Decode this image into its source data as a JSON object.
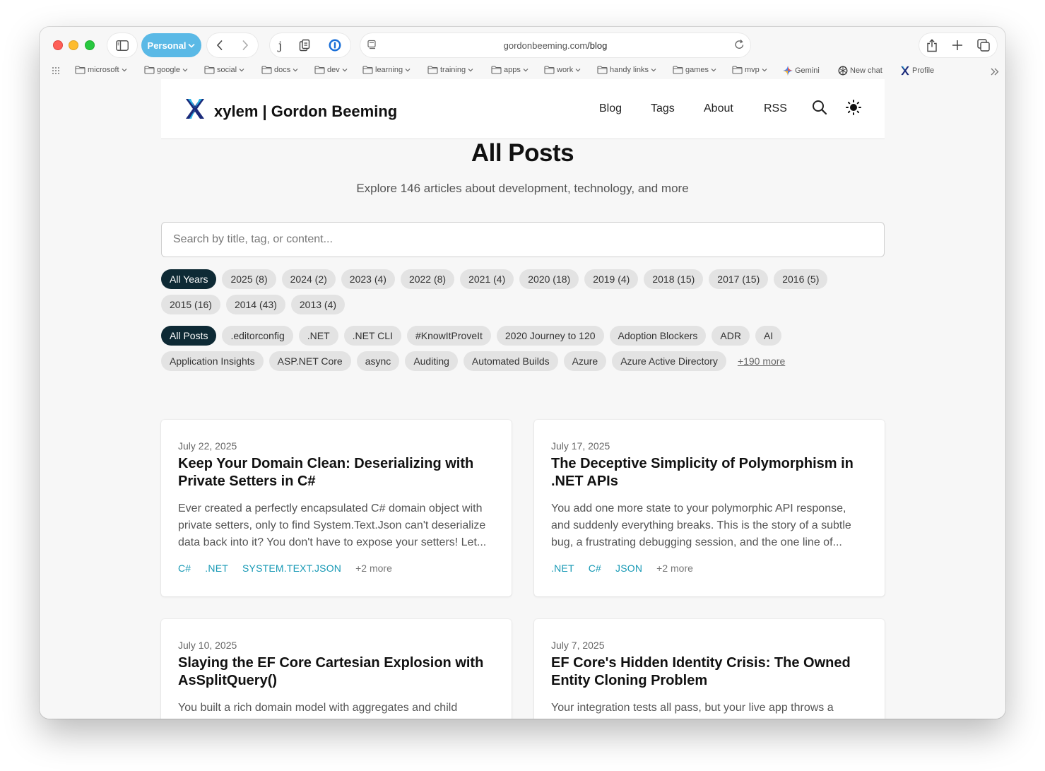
{
  "browser": {
    "profile_label": "Personal",
    "url_domain": "gordonbeeming.com",
    "url_path": "/blog",
    "extension_letter": "j",
    "bookmarks": [
      {
        "label": "microsoft",
        "icon": "folder-icon",
        "dropdown": true
      },
      {
        "label": "google",
        "icon": "folder-icon",
        "dropdown": true
      },
      {
        "label": "social",
        "icon": "folder-icon",
        "dropdown": true
      },
      {
        "label": "docs",
        "icon": "folder-icon",
        "dropdown": true
      },
      {
        "label": "dev",
        "icon": "folder-icon",
        "dropdown": true
      },
      {
        "label": "learning",
        "icon": "folder-icon",
        "dropdown": true
      },
      {
        "label": "training",
        "icon": "folder-icon",
        "dropdown": true
      },
      {
        "label": "apps",
        "icon": "folder-icon",
        "dropdown": true
      },
      {
        "label": "work",
        "icon": "folder-icon",
        "dropdown": true
      },
      {
        "label": "handy links",
        "icon": "folder-icon",
        "dropdown": true
      },
      {
        "label": "games",
        "icon": "folder-icon",
        "dropdown": true
      },
      {
        "label": "mvp",
        "icon": "folder-icon",
        "dropdown": true
      },
      {
        "label": "Gemini",
        "icon": "gemini-icon",
        "dropdown": false
      },
      {
        "label": "New chat",
        "icon": "openai-icon",
        "dropdown": false
      },
      {
        "label": "Profile",
        "icon": "xylem-icon",
        "dropdown": false
      }
    ]
  },
  "site": {
    "title": "xylem | Gordon Beeming",
    "nav": [
      "Blog",
      "Tags",
      "About",
      "RSS"
    ]
  },
  "main": {
    "title": "All Posts",
    "subtitle": "Explore 146 articles about development, technology, and more",
    "search_placeholder": "Search by title, tag, or content...",
    "year_filters": [
      "All Years",
      "2025 (8)",
      "2024 (2)",
      "2023 (4)",
      "2022 (8)",
      "2021 (4)",
      "2020 (18)",
      "2019 (4)",
      "2018 (15)",
      "2017 (15)",
      "2016 (5)",
      "2015 (16)",
      "2014 (43)",
      "2013 (4)"
    ],
    "tag_filters": [
      "All Posts",
      ".editorconfig",
      ".NET",
      ".NET CLI",
      "#KnowItProveIt",
      "2020 Journey to 120",
      "Adoption Blockers",
      "ADR",
      "AI",
      "Application Insights",
      "ASP.NET Core",
      "async",
      "Auditing",
      "Automated Builds",
      "Azure",
      "Azure Active Directory"
    ],
    "tag_more": "+190 more",
    "posts": [
      {
        "date": "July 22, 2025",
        "title": "Keep Your Domain Clean: Deserializing with Private Setters in C#",
        "excerpt": "Ever created a perfectly encapsulated C# domain object with private setters, only to find System.Text.Json can't deserialize data back into it? You don't have to expose your setters! Let...",
        "tags": [
          "C#",
          ".NET",
          "System.Text.Json"
        ],
        "more": "+2 more"
      },
      {
        "date": "July 17, 2025",
        "title": "The Deceptive Simplicity of Polymorphism in .NET APIs",
        "excerpt": "You add one more state to your polymorphic API response, and suddenly everything breaks. This is the story of a subtle bug, a frustrating debugging session, and the one line of...",
        "tags": [
          ".NET",
          "C#",
          "JSON"
        ],
        "more": "+2 more"
      },
      {
        "date": "July 10, 2025",
        "title": "Slaying the EF Core Cartesian Explosion with AsSplitQuery()",
        "excerpt": "You built a rich domain model with aggregates and child collections, but now your queries are painfully slow. Learn how a one-line change in Entity Framework Core...",
        "tags": [],
        "more": ""
      },
      {
        "date": "July 7, 2025",
        "title": "EF Core's Hidden Identity Crisis: The Owned Entity Cloning Problem",
        "excerpt": "Your integration tests all pass, but your live app throws a cryptic EF Core error about modifying a key that doesn't even exist. Let's dive into the fascinating reason why and how to f...",
        "tags": [],
        "more": ""
      }
    ]
  },
  "colors": {
    "active_chip": "#0e2a35",
    "tag_text": "#1799b5",
    "profile_pill": "#5ab9e6"
  }
}
